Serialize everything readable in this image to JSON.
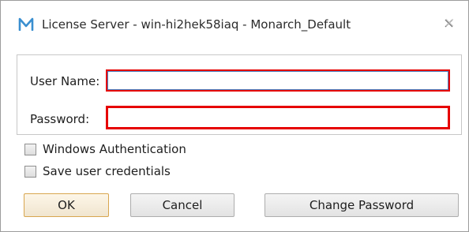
{
  "window": {
    "title": "License Server - win-hi2hek58iaq - Monarch_Default",
    "logo_letter": "M",
    "close_glyph": "✕"
  },
  "form": {
    "user_name_label": "User Name:",
    "user_name_value": "",
    "password_label": "Password:",
    "password_value": ""
  },
  "options": {
    "windows_auth_label": "Windows Authentication",
    "windows_auth_checked": false,
    "save_credentials_label": "Save user credentials",
    "save_credentials_checked": false
  },
  "buttons": {
    "ok_label": "OK",
    "cancel_label": "Cancel",
    "change_password_label": "Change Password"
  },
  "colors": {
    "logo": "#3a8fd0",
    "error_border": "#e60000",
    "focus_border": "#4a7fc1",
    "default_button_border": "#d8a64f"
  },
  "icons": {
    "logo": "monarch-logo-icon",
    "close": "close-icon"
  }
}
